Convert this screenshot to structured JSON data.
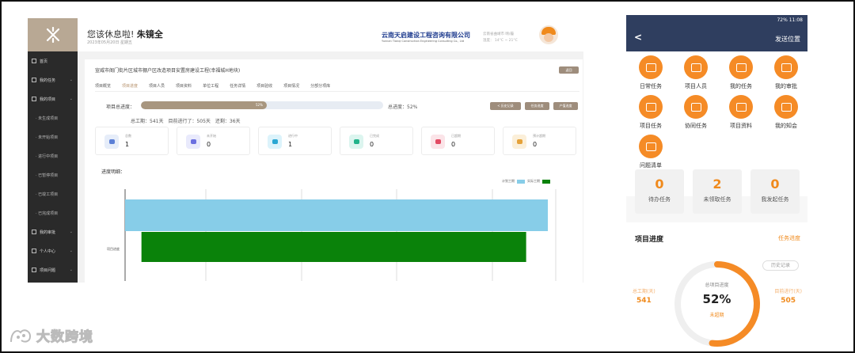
{
  "desktop": {
    "greeting": "您该休息啦!",
    "user_name": "朱镜全",
    "date": "2023年05月20日 星期五",
    "company_cn": "云南天启建设工程咨询有限公司",
    "company_en": "Yunnan Tianqi Construction Engineering Consulting Co., Ltd",
    "weather_city": "云南省曲靖市 晴/霾",
    "weather_temp": "温度： 14°C ~ 21°C",
    "sidebar": [
      {
        "label": "首页",
        "sub": false
      },
      {
        "label": "我的任务",
        "sub": false
      },
      {
        "label": "我的项目",
        "sub": false
      },
      {
        "label": "· 未生成项目",
        "sub": true
      },
      {
        "label": "· 未开始项目",
        "sub": true
      },
      {
        "label": "· 进行中项目",
        "sub": true
      },
      {
        "label": "· 已暂停项目",
        "sub": true
      },
      {
        "label": "· 已竣工项目",
        "sub": true
      },
      {
        "label": "· 已完成项目",
        "sub": true
      },
      {
        "label": "我的审批",
        "sub": false
      },
      {
        "label": "个人中心",
        "sub": false
      },
      {
        "label": "项目问题",
        "sub": false
      }
    ],
    "project_title": "宣威市阁门街片区城市棚户区改造项目安置房建设工程(幸福城H地块)",
    "project_btn": "返回",
    "tabs": [
      "项目概览",
      "项目进度",
      "项目人员",
      "项目资料",
      "单位工程",
      "任务详情",
      "项目验收",
      "项目情况",
      "分部分项库"
    ],
    "active_tab": 1,
    "progress_label": "项目总进度：",
    "progress_value": 52,
    "progress_text": "52%",
    "progress_total": "总进度：52%",
    "action_buttons": [
      "< 历史记录",
      "任务进度",
      "产值进度"
    ],
    "periods": "总工期：541天　目前进行了：505天　还剩：36天",
    "cards": [
      {
        "label": "总数",
        "value": "1",
        "bg": "#e6edf9",
        "fg": "#5b7fd6"
      },
      {
        "label": "未开始",
        "value": "0",
        "bg": "#e9eafc",
        "fg": "#6b6fe0"
      },
      {
        "label": "进行中",
        "value": "1",
        "bg": "#dcf3fb",
        "fg": "#2aa7d3"
      },
      {
        "label": "已完成",
        "value": "0",
        "bg": "#dcf5ef",
        "fg": "#22b38a"
      },
      {
        "label": "已超期",
        "value": "0",
        "bg": "#fbe4e8",
        "fg": "#e24a63"
      },
      {
        "label": "预计超期",
        "value": "0",
        "bg": "#fbefd9",
        "fg": "#e5a23a"
      }
    ],
    "progress_detail_label": "进度明细：",
    "legend": [
      "计划工期",
      "实际工期"
    ],
    "gantt_row_label": "项目进度",
    "chart_data": {
      "type": "bar",
      "categories": [
        "项目进度"
      ],
      "series": [
        {
          "name": "计划工期",
          "color": "#87cde8",
          "range": [
            0,
            100
          ]
        },
        {
          "name": "实际工期",
          "color": "#0a820a",
          "range": [
            2,
            93
          ]
        }
      ]
    }
  },
  "phone": {
    "status": "72% 11:08",
    "back": "<",
    "nav_right": "发送位置",
    "grid": [
      "日常任务",
      "项目人员",
      "我的任务",
      "我的审批",
      "项目任务",
      "协同任务",
      "项目资料",
      "我的知会",
      "问题清单"
    ],
    "counters": [
      {
        "value": "0",
        "label": "待办任务"
      },
      {
        "value": "2",
        "label": "未领取任务"
      },
      {
        "value": "0",
        "label": "我发起任务"
      }
    ],
    "progress_title": "项目进度",
    "progress_link": "任务进度",
    "history_btn": "历史记录",
    "ring_label": "总项目进度",
    "ring_pct": "52%",
    "ring_value": 52,
    "ring_status": "未超期",
    "left_label": "总工期(天)",
    "left_value": "541",
    "right_label": "目前进行(天)",
    "right_value": "505"
  },
  "watermark": "大数跨境",
  "colors": {
    "accent": "#f08a1c",
    "brand_desktop": "#9e8d7c",
    "navbar": "#2f3e5f"
  }
}
